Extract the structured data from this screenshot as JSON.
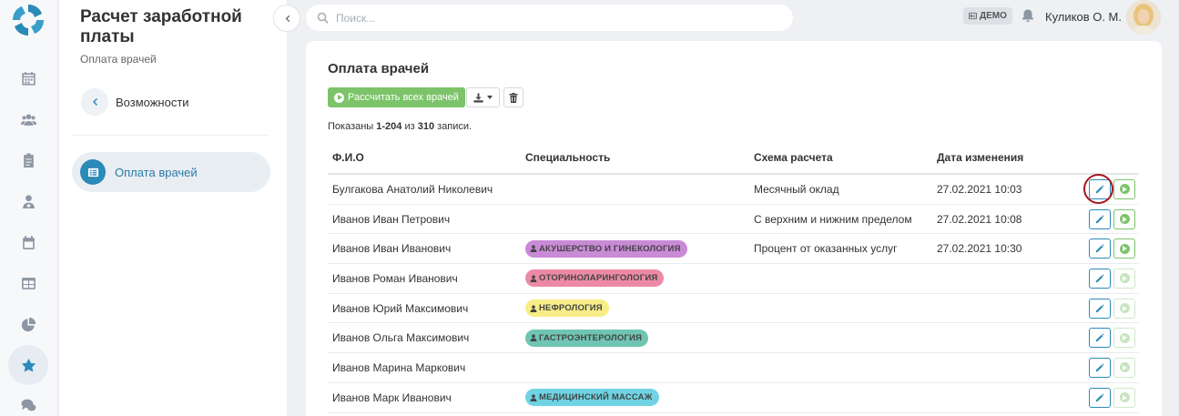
{
  "sidebar": {
    "title": "Расчет заработной платы",
    "subtitle": "Оплата врачей",
    "back_label": "Возможности",
    "active_item": "Оплата врачей"
  },
  "rail": {
    "icons": [
      "calendar-icon",
      "users-icon",
      "clipboard-icon",
      "doctor-icon",
      "calendar-alt-icon",
      "table-icon",
      "pie-chart-icon",
      "star-icon",
      "comments-icon"
    ],
    "active": "star-icon"
  },
  "topbar": {
    "search_placeholder": "Поиск...",
    "demo_label": "ДЕМО",
    "user_name": "Куликов О. М."
  },
  "page": {
    "title": "Оплата врачей",
    "calc_all_label": "Рассчитать всех врачей",
    "summary_prefix": "Показаны ",
    "summary_range": "1-204",
    "summary_mid": " из ",
    "summary_total": "310",
    "summary_suffix": " записи."
  },
  "table": {
    "headers": [
      "Ф.И.О",
      "Специальность",
      "Схема расчета",
      "Дата изменения"
    ],
    "rows": [
      {
        "name": "Булгакова Анатолий Николевич",
        "specialty": "",
        "scheme": "Месячный оклад",
        "date": "27.02.2021 10:03",
        "play_enabled": true
      },
      {
        "name": "Иванов Иван Петрович",
        "specialty": "",
        "scheme": "С верхним и нижним пределом",
        "date": "27.02.2021 10:08",
        "play_enabled": true
      },
      {
        "name": "Иванов Иван Иванович",
        "specialty": "АКУШЕРСТВО И ГИНЕКОЛОГИЯ",
        "specialty_color": "#c98ad6",
        "scheme": "Процент от оказанных услуг",
        "date": "27.02.2021 10:30",
        "play_enabled": true
      },
      {
        "name": "Иванов Роман Иванович",
        "specialty": "ОТОРИНОЛАРИНГОЛОГИЯ",
        "specialty_color": "#ec8aa6",
        "scheme": "",
        "date": "",
        "play_enabled": false
      },
      {
        "name": "Иванов Юрий Максимович",
        "specialty": "НЕФРОЛОГИЯ",
        "specialty_color": "#f8ec86",
        "scheme": "",
        "date": "",
        "play_enabled": false
      },
      {
        "name": "Иванов Ольга Максимович",
        "specialty": "ГАСТРОЭНТЕРОЛОГИЯ",
        "specialty_color": "#6fc5b3",
        "scheme": "",
        "date": "",
        "play_enabled": false
      },
      {
        "name": "Иванов Марина Маркович",
        "specialty": "",
        "scheme": "",
        "date": "",
        "play_enabled": false
      },
      {
        "name": "Иванов Марк Иванович",
        "specialty": "МЕДИЦИНСКИЙ МАССАЖ",
        "specialty_color": "#6fd3e3",
        "scheme": "",
        "date": "",
        "play_enabled": false
      }
    ]
  },
  "colors": {
    "accent": "#2a8ab8",
    "success": "#7cc36a",
    "highlight": "#a4161e"
  }
}
